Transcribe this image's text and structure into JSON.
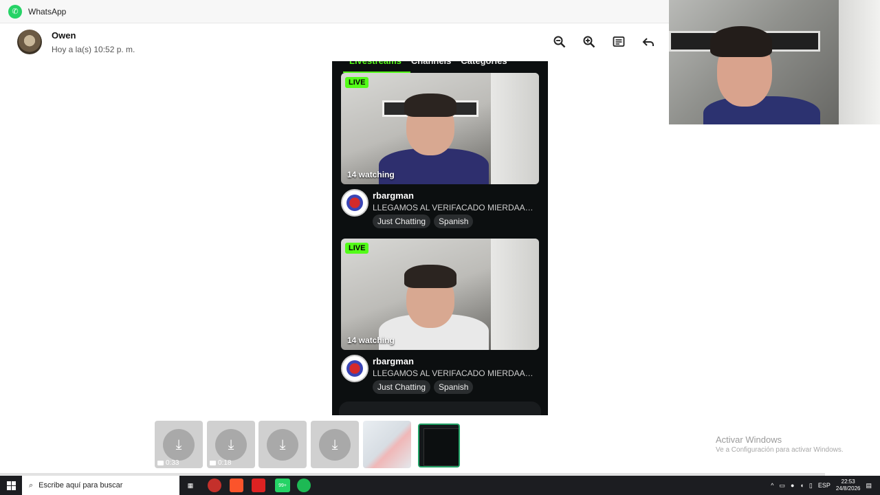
{
  "titlebar": {
    "app_name": "WhatsApp"
  },
  "header": {
    "contact_name": "Owen",
    "status": "Hoy a la(s) 10:52 p. m."
  },
  "media": {
    "tabs": [
      "Livestreams",
      "Channels",
      "Categories"
    ],
    "cards": [
      {
        "badge": "LIVE",
        "watching": "14 watching",
        "channel": "rbargman",
        "title": "LLEGAMOS AL VERIFACADO MIERDAAA! E...",
        "tags": [
          "Just Chatting",
          "Spanish"
        ]
      },
      {
        "badge": "LIVE",
        "watching": "14 watching",
        "channel": "rbargman",
        "title": "LLEGAMOS AL VERIFACADO MIERDAAA! E...",
        "tags": [
          "Just Chatting",
          "Spanish"
        ]
      }
    ]
  },
  "strip": {
    "items": [
      {
        "type": "video",
        "duration": "0:33"
      },
      {
        "type": "video",
        "duration": "0:18"
      },
      {
        "type": "download"
      },
      {
        "type": "download"
      },
      {
        "type": "image-map"
      },
      {
        "type": "image-selected"
      }
    ]
  },
  "watermark": {
    "line1": "Activar Windows",
    "line2": "Ve a Configuración para activar Windows."
  },
  "taskbar": {
    "search_placeholder": "Escribe aquí para buscar",
    "badge_count": "99+",
    "lang": "ESP",
    "time": "22:53",
    "date": "24/8/2026"
  },
  "icons": {
    "zoom_out": "zoom-out-icon",
    "zoom_in": "zoom-in-icon",
    "caption": "message-icon",
    "reply": "reply-icon"
  }
}
